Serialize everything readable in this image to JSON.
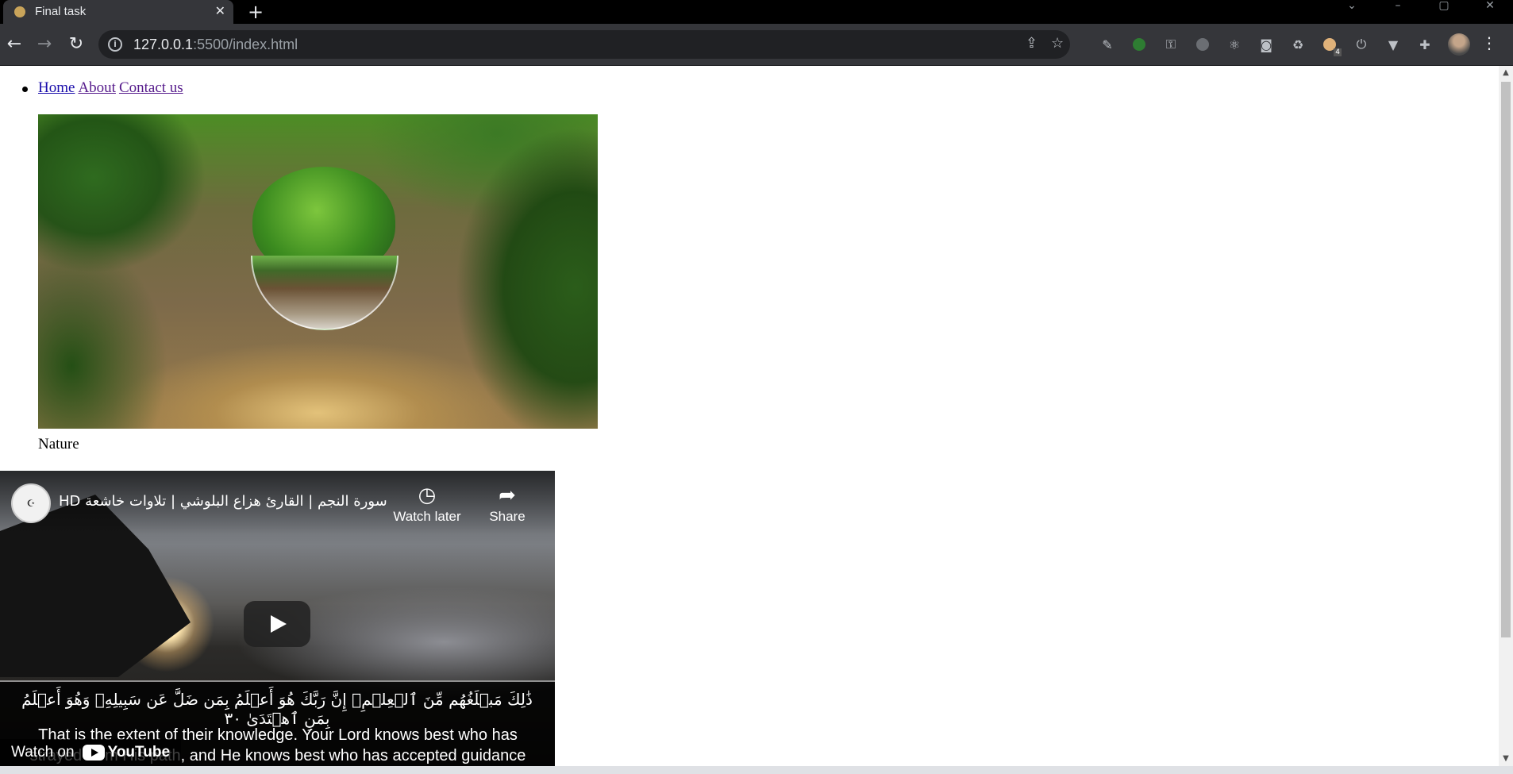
{
  "browser": {
    "tab_title": "Final task",
    "tab_close": "✕",
    "new_tab": "+",
    "back": "←",
    "forward": "→",
    "reload": "↻",
    "url_host": "127.0.0.1",
    "url_path": ":5500/index.html",
    "share_glyph": "⇪",
    "bookmark_glyph": "☆",
    "menu_glyph": "⋮",
    "extension_badge": "4"
  },
  "nav": {
    "links": [
      "Home",
      "About",
      "Contact us"
    ]
  },
  "figure": {
    "caption": "Nature"
  },
  "video": {
    "title": "سورة النجم | القارئ هزاع البلوشي | تلاوات خاشعة HD",
    "watch_later": "Watch later",
    "share": "Share",
    "arabic_verse": "ذَٰلِكَ مَبۡلَغُهُم مِّنَ ٱلۡعِلۡمِۚ إِنَّ رَبَّكَ هُوَ أَعۡلَمُ بِمَن ضَلَّ عَن سَبِيلِهِۦ وَهُوَ أَعۡلَمُ بِمَنِ ٱهۡتَدَىٰ ٣٠",
    "english_line_1": "That is the extent of their knowledge. Your Lord knows best who has",
    "english_line_2": "strayed from His path, and He knows best who has accepted guidance",
    "watch_on": "Watch on",
    "youtube": "YouTube"
  },
  "colors": {
    "link_visited": "#551a8b",
    "link": "#1a0dab",
    "chrome_dark": "#35363a"
  }
}
